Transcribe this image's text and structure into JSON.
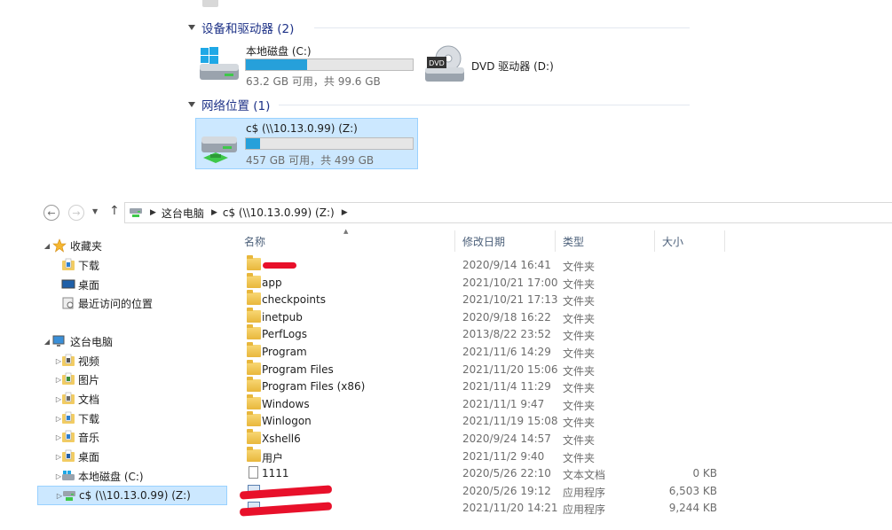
{
  "groups": {
    "devices": {
      "title": "设备和驱动器 (2)"
    },
    "network": {
      "title": "网络位置 (1)"
    }
  },
  "drives": [
    {
      "name": "本地磁盘 (C:)",
      "free_text": "63.2 GB 可用，共 99.6 GB",
      "used_fraction": 0.365,
      "icon": "windows-drive-icon"
    },
    {
      "name": "DVD 驱动器 (D:)",
      "icon": "dvd-drive-icon"
    },
    {
      "name": "c$ (\\\\10.13.0.99) (Z:)",
      "free_text": "457 GB 可用，共 499 GB",
      "used_fraction": 0.084,
      "icon": "network-drive-icon",
      "selected": true
    }
  ],
  "address_bar": {
    "segments": [
      "这台电脑",
      "c$ (\\\\10.13.0.99) (Z:)"
    ]
  },
  "nav_pane": {
    "items": [
      {
        "label": "收藏夹",
        "level": 0,
        "icon": "star-icon",
        "expander": "◢"
      },
      {
        "label": "下载",
        "level": 1,
        "icon": "download-folder-icon"
      },
      {
        "label": "桌面",
        "level": 1,
        "icon": "desktop-icon"
      },
      {
        "label": "最近访问的位置",
        "level": 1,
        "icon": "recent-places-icon"
      },
      {
        "label": "这台电脑",
        "level": 0,
        "icon": "computer-icon",
        "expander": "◢"
      },
      {
        "label": "视频",
        "level": 1,
        "icon": "videos-folder-icon",
        "expander": "▷"
      },
      {
        "label": "图片",
        "level": 1,
        "icon": "pictures-folder-icon",
        "expander": "▷"
      },
      {
        "label": "文档",
        "level": 1,
        "icon": "documents-folder-icon",
        "expander": "▷"
      },
      {
        "label": "下载",
        "level": 1,
        "icon": "download-folder-icon",
        "expander": "▷"
      },
      {
        "label": "音乐",
        "level": 1,
        "icon": "music-folder-icon",
        "expander": "▷"
      },
      {
        "label": "桌面",
        "level": 1,
        "icon": "desktop-folder-icon",
        "expander": "▷"
      },
      {
        "label": "本地磁盘 (C:)",
        "level": 1,
        "icon": "local-disk-icon",
        "expander": "▷"
      },
      {
        "label": "c$ (\\\\10.13.0.99) (Z:)",
        "level": 1,
        "icon": "network-drive-icon",
        "expander": "▷",
        "selected": true
      }
    ]
  },
  "columns": {
    "name": "名称",
    "date": "修改日期",
    "type": "类型",
    "size": "大小"
  },
  "files": [
    {
      "name": "",
      "date": "2020/9/14 16:41",
      "type": "文件夹",
      "size": "",
      "kind": "folder",
      "redacted": true
    },
    {
      "name": "app",
      "date": "2021/10/21 17:00",
      "type": "文件夹",
      "size": "",
      "kind": "folder"
    },
    {
      "name": "checkpoints",
      "date": "2021/10/21 17:13",
      "type": "文件夹",
      "size": "",
      "kind": "folder"
    },
    {
      "name": "inetpub",
      "date": "2020/9/18 16:22",
      "type": "文件夹",
      "size": "",
      "kind": "folder"
    },
    {
      "name": "PerfLogs",
      "date": "2013/8/22 23:52",
      "type": "文件夹",
      "size": "",
      "kind": "folder"
    },
    {
      "name": "Program",
      "date": "2021/11/6 14:29",
      "type": "文件夹",
      "size": "",
      "kind": "folder"
    },
    {
      "name": "Program Files",
      "date": "2021/11/20 15:06",
      "type": "文件夹",
      "size": "",
      "kind": "folder"
    },
    {
      "name": "Program Files (x86)",
      "date": "2021/11/4 11:29",
      "type": "文件夹",
      "size": "",
      "kind": "folder"
    },
    {
      "name": "Windows",
      "date": "2021/11/1 9:47",
      "type": "文件夹",
      "size": "",
      "kind": "folder"
    },
    {
      "name": "Winlogon",
      "date": "2021/11/19 15:08",
      "type": "文件夹",
      "size": "",
      "kind": "folder"
    },
    {
      "name": "Xshell6",
      "date": "2020/9/24 14:57",
      "type": "文件夹",
      "size": "",
      "kind": "folder"
    },
    {
      "name": "用户",
      "date": "2021/11/2 9:40",
      "type": "文件夹",
      "size": "",
      "kind": "folder"
    },
    {
      "name": "1111",
      "date": "2020/5/26 22:10",
      "type": "文本文档",
      "size": "0 KB",
      "kind": "text"
    },
    {
      "name": "",
      "date": "2020/5/26 19:12",
      "type": "应用程序",
      "size": "6,503 KB",
      "kind": "app",
      "redacted": true
    },
    {
      "name": "",
      "date": "2021/11/20 14:21",
      "type": "应用程序",
      "size": "9,244 KB",
      "kind": "app",
      "redacted": true
    }
  ],
  "colors": {
    "accent": "#26a0da",
    "selection": "#cce8ff",
    "selection_border": "#99d1ff",
    "redact": "#e8102a",
    "group_title": "#1e3287"
  }
}
